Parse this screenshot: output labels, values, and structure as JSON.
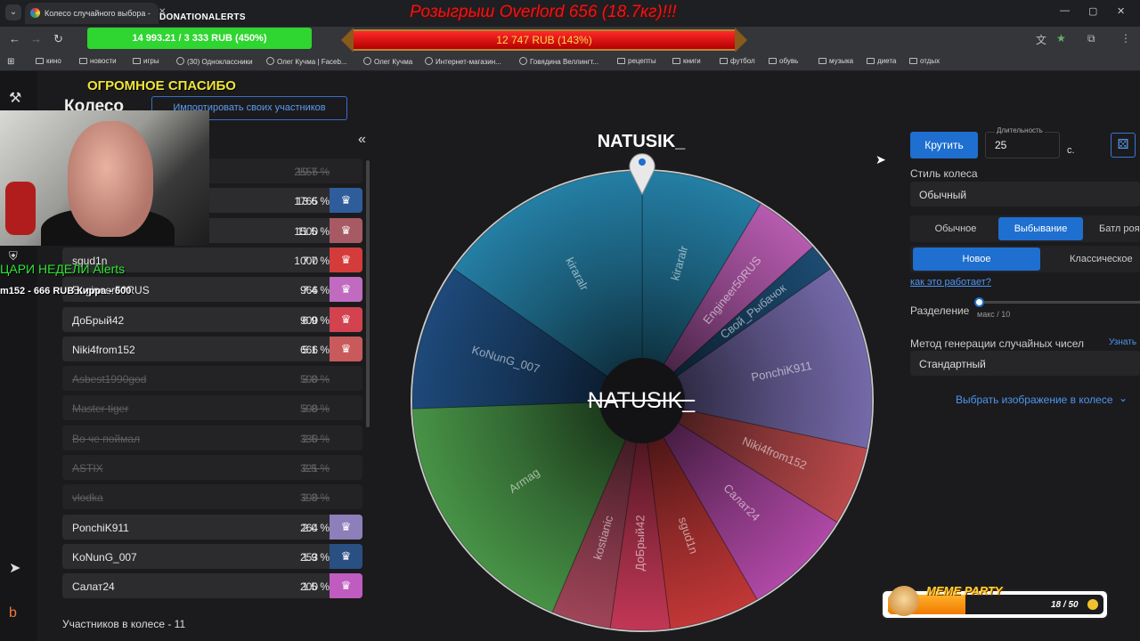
{
  "browser": {
    "tab_title": "Колесо случайного выбора -",
    "overlay_brand": "DONATIONALERTS",
    "giveaway_title": "Розыгрыш Overlord 656 (18.7кг)!!!",
    "goal_green": "14 993.21 / 3 333 RUB (450%)",
    "goal_red": "12 747 RUB (143%)",
    "bookmarks": [
      {
        "label": "кино",
        "type": "folder"
      },
      {
        "label": "новости",
        "type": "folder"
      },
      {
        "label": "игры",
        "type": "folder"
      },
      {
        "label": "(30) Одноклассники",
        "type": "site"
      },
      {
        "label": "Олег Кучма | Faceb...",
        "type": "site"
      },
      {
        "label": "Олег Кучма",
        "type": "site"
      },
      {
        "label": "Интернет-магазин...",
        "type": "site"
      },
      {
        "label": "Говядина Веллингт...",
        "type": "site"
      },
      {
        "label": "рецепты",
        "type": "folder"
      },
      {
        "label": "книги",
        "type": "folder"
      },
      {
        "label": "футбол",
        "type": "folder"
      },
      {
        "label": "обувь",
        "type": "folder"
      },
      {
        "label": "музыка",
        "type": "folder"
      },
      {
        "label": "диета",
        "type": "folder"
      },
      {
        "label": "отдых",
        "type": "folder"
      }
    ]
  },
  "page": {
    "title": "Колесо",
    "import_button": "Импортировать своих участников",
    "collapse_icon": "«",
    "participants_count": "Участников в колесе - 11"
  },
  "participants": [
    {
      "name": "",
      "amount": "2555",
      "percent": "19.7 %",
      "out": true,
      "bulb_color": ""
    },
    {
      "name": "",
      "amount": "1765",
      "percent": "13.6 %",
      "out": false,
      "bulb_color": "#2f5d9c"
    },
    {
      "name": "",
      "amount": "1500",
      "percent": "11.5 %",
      "out": false,
      "bulb_color": "#a75a63"
    },
    {
      "name": "sgud1n",
      "amount": "1000",
      "percent": "7.7 %",
      "out": false,
      "bulb_color": "#d43b3b"
    },
    {
      "name": "Engineer50RUS",
      "amount": "966",
      "percent": "7.4 %",
      "out": false,
      "bulb_color": "#c06bc0"
    },
    {
      "name": "ДоБрый42",
      "amount": "900",
      "percent": "6.9 %",
      "out": false,
      "bulb_color": "#d2424f"
    },
    {
      "name": "Niki4from152",
      "amount": "666",
      "percent": "5.1 %",
      "out": false,
      "bulb_color": "#c85a5c"
    },
    {
      "name": "Asbest1990god",
      "amount": "500",
      "percent": "3.8 %",
      "out": true,
      "bulb_color": ""
    },
    {
      "name": "Master tiger",
      "amount": "500",
      "percent": "3.8 %",
      "out": true,
      "bulb_color": ""
    },
    {
      "name": "Во че поймал",
      "amount": "330",
      "percent": "2.5 %",
      "out": true,
      "bulb_color": ""
    },
    {
      "name": "ASTIX",
      "amount": "321",
      "percent": "2.5 %",
      "out": true,
      "bulb_color": ""
    },
    {
      "name": "vlodka",
      "amount": "300",
      "percent": "2.3 %",
      "out": true,
      "bulb_color": ""
    },
    {
      "name": "PonchiK911",
      "amount": "264",
      "percent": "2.0 %",
      "out": false,
      "bulb_color": "#8d7fb9"
    },
    {
      "name": "KoNunG_007",
      "amount": "253",
      "percent": "1.9 %",
      "out": false,
      "bulb_color": "#2a4f82"
    },
    {
      "name": "Салат24",
      "amount": "200",
      "percent": "1.5 %",
      "out": false,
      "bulb_color": "#c05cc0"
    }
  ],
  "wheel": {
    "winner": "NATUSIK_",
    "center_text": "NATUSIK_",
    "segments": [
      {
        "label": "kiraralr",
        "from": 0,
        "to": 31,
        "color": "#2685ad"
      },
      {
        "label": "Engineer50RUS",
        "from": 31,
        "to": 48,
        "color": "#c060b8"
      },
      {
        "label": "Свой_Рыбачок",
        "from": 48,
        "to": 55,
        "color": "#1e4f78"
      },
      {
        "label": "PonchiK911",
        "from": 55,
        "to": 102,
        "color": "#7b6fb2"
      },
      {
        "label": "Niki4from152",
        "from": 102,
        "to": 122,
        "color": "#c44d4f"
      },
      {
        "label": "Салат24",
        "from": 122,
        "to": 150,
        "color": "#b84cae"
      },
      {
        "label": "sgud1n",
        "from": 150,
        "to": 173,
        "color": "#cc3a3a"
      },
      {
        "label": "ДоБрый42",
        "from": 173,
        "to": 188,
        "color": "#cc3a5a"
      },
      {
        "label": "kostianic",
        "from": 188,
        "to": 203,
        "color": "#a8485d"
      },
      {
        "label": "Armag",
        "from": 203,
        "to": 268,
        "color": "#4b9a4a"
      },
      {
        "label": "KoNunG_007",
        "from": 268,
        "to": 305,
        "color": "#1f4d80"
      },
      {
        "label": "kiraralr",
        "from": 305,
        "to": 360,
        "color": "#2685ad"
      }
    ]
  },
  "settings": {
    "spin_button": "Крутить",
    "duration_label": "Длительность",
    "duration_value": "25",
    "duration_unit": "с.",
    "wheel_style_label": "Стиль колеса",
    "wheel_style_value": "Обычный",
    "modes": [
      "Обычное",
      "Выбывание",
      "Батл роя"
    ],
    "mode_active": 1,
    "submodes": [
      "Новое",
      "Классическое"
    ],
    "submode_active": 0,
    "how_it_works": "как это работает?",
    "split_label": "Разделение",
    "split_hint": "макс / 10",
    "rng_label": "Метод генерации случайных чисел",
    "rng_learn": "Узнать",
    "rng_value": "Стандартный",
    "choose_image": "Выбрать изображение в колесе"
  },
  "overlays": {
    "thanks": "ОГРОМНОЕ СПАСИБО",
    "kings": "ЦАРИ НЕДЕЛИ Alerts",
    "kings_sub": "m152 - 666 RUB   Кирра - 600",
    "meme_title": "MEME PARTY",
    "meme_count": "18 / 50",
    "meme_progress": 0.36
  }
}
